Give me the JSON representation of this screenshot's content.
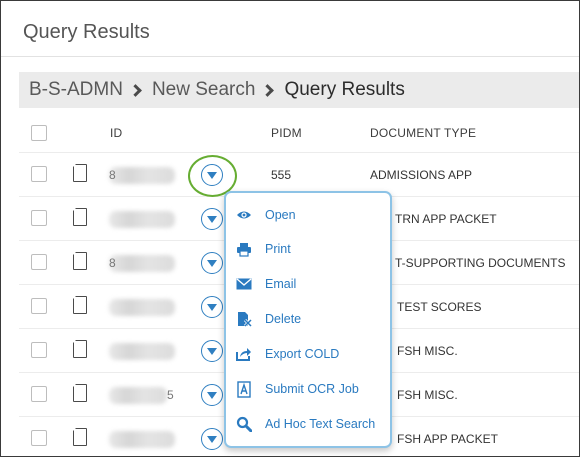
{
  "page": {
    "title": "Query Results"
  },
  "breadcrumb": [
    {
      "label": "B-S-ADMN"
    },
    {
      "label": "New Search"
    },
    {
      "label": "Query Results"
    }
  ],
  "table": {
    "columns": {
      "id": "ID",
      "pidm": "PIDM",
      "document_type": "DOCUMENT TYPE"
    },
    "rows": [
      {
        "id_fragment": "8",
        "id_tail": "",
        "pidm": "555",
        "document_type": "ADMISSIONS APP"
      },
      {
        "id_fragment": "",
        "id_tail": "",
        "pidm": "",
        "document_type": "TRN APP PACKET"
      },
      {
        "id_fragment": "8",
        "id_tail": "",
        "pidm": "",
        "document_type": "T-SUPPORTING DOCUMENTS"
      },
      {
        "id_fragment": "",
        "id_tail": "",
        "pidm": "",
        "document_type": "TEST SCORES"
      },
      {
        "id_fragment": "",
        "id_tail": "",
        "pidm": "",
        "document_type": "FSH MISC."
      },
      {
        "id_fragment": "",
        "id_tail": "5",
        "pidm": "",
        "document_type": "FSH MISC."
      },
      {
        "id_fragment": "",
        "id_tail": "",
        "pidm": "",
        "document_type": "FSH APP PACKET"
      }
    ]
  },
  "context_menu": {
    "items": [
      {
        "label": "Open",
        "icon": "eye-icon"
      },
      {
        "label": "Print",
        "icon": "printer-icon"
      },
      {
        "label": "Email",
        "icon": "envelope-icon"
      },
      {
        "label": "Delete",
        "icon": "delete-document-icon"
      },
      {
        "label": "Export COLD",
        "icon": "export-icon"
      },
      {
        "label": "Submit OCR Job",
        "icon": "ocr-document-icon"
      },
      {
        "label": "Ad Hoc Text Search",
        "icon": "search-icon"
      }
    ]
  },
  "colors": {
    "accent": "#2f7fc1",
    "highlight": "#66ad32",
    "menu_border": "#8dc3e6"
  }
}
